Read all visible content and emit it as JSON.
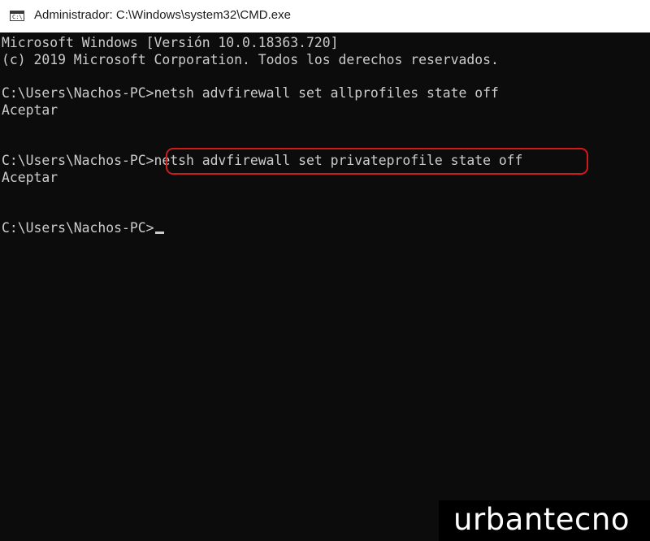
{
  "window": {
    "title": "Administrador: C:\\Windows\\system32\\CMD.exe",
    "icon": "cmd-window-icon",
    "icon_glyph": "C:\\."
  },
  "console": {
    "lines": [
      "Microsoft Windows [Versión 10.0.18363.720]",
      "(c) 2019 Microsoft Corporation. Todos los derechos reservados.",
      "",
      "C:\\Users\\Nachos-PC>netsh advfirewall set allprofiles state off",
      "Aceptar",
      "",
      "",
      "C:\\Users\\Nachos-PC>netsh advfirewall set privateprofile state off",
      "Aceptar",
      "",
      "",
      "C:\\Users\\Nachos-PC>"
    ],
    "highlighted_command": "netsh advfirewall set privateprofile state off",
    "colors": {
      "background": "#0c0c0c",
      "text": "#cccccc",
      "highlight_border": "#d11a1a"
    }
  },
  "watermark": {
    "text": "urbantecno"
  }
}
